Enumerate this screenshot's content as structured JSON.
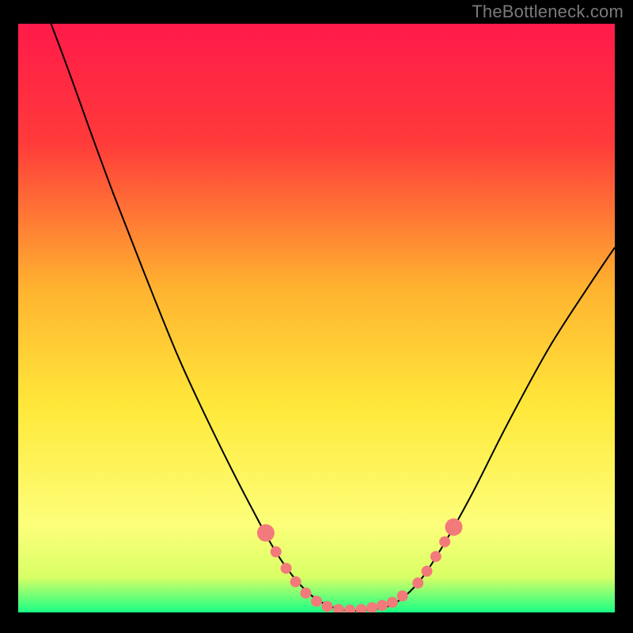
{
  "attribution": "TheBottleneck.com",
  "chart_data": {
    "type": "line",
    "title": "",
    "xlabel": "",
    "ylabel": "",
    "xlim": [
      0,
      100
    ],
    "ylim": [
      0,
      100
    ],
    "background_gradient": {
      "stops": [
        {
          "offset": 0.0,
          "color": "#ff1a4a"
        },
        {
          "offset": 0.2,
          "color": "#ff3a3a"
        },
        {
          "offset": 0.45,
          "color": "#ffb330"
        },
        {
          "offset": 0.65,
          "color": "#ffe83a"
        },
        {
          "offset": 0.85,
          "color": "#fdff7a"
        },
        {
          "offset": 0.94,
          "color": "#d9ff66"
        },
        {
          "offset": 1.0,
          "color": "#19ff84"
        }
      ]
    },
    "series": [
      {
        "name": "bottleneck-curve",
        "color": "#000000",
        "stroke_width": 2,
        "points": [
          {
            "x": 5.5,
            "y": 100.0
          },
          {
            "x": 7.0,
            "y": 96.0
          },
          {
            "x": 9.0,
            "y": 90.5
          },
          {
            "x": 12.0,
            "y": 82.0
          },
          {
            "x": 16.0,
            "y": 71.0
          },
          {
            "x": 21.0,
            "y": 58.0
          },
          {
            "x": 27.0,
            "y": 43.0
          },
          {
            "x": 33.0,
            "y": 30.0
          },
          {
            "x": 39.0,
            "y": 18.0
          },
          {
            "x": 44.0,
            "y": 9.0
          },
          {
            "x": 49.0,
            "y": 3.0
          },
          {
            "x": 54.0,
            "y": 0.5
          },
          {
            "x": 59.0,
            "y": 0.5
          },
          {
            "x": 63.0,
            "y": 1.5
          },
          {
            "x": 67.0,
            "y": 5.0
          },
          {
            "x": 71.0,
            "y": 11.0
          },
          {
            "x": 76.0,
            "y": 20.0
          },
          {
            "x": 82.0,
            "y": 32.0
          },
          {
            "x": 89.0,
            "y": 45.0
          },
          {
            "x": 96.0,
            "y": 56.0
          },
          {
            "x": 100.0,
            "y": 62.0
          }
        ]
      }
    ],
    "markers": {
      "name": "highlight-dots",
      "color": "#f27a7a",
      "radius": 7,
      "end_radius": 11,
      "points": [
        {
          "x": 41.5,
          "y": 13.5
        },
        {
          "x": 43.2,
          "y": 10.3
        },
        {
          "x": 44.9,
          "y": 7.5
        },
        {
          "x": 46.5,
          "y": 5.2
        },
        {
          "x": 48.2,
          "y": 3.3
        },
        {
          "x": 50.0,
          "y": 1.9
        },
        {
          "x": 51.8,
          "y": 1.0
        },
        {
          "x": 53.7,
          "y": 0.5
        },
        {
          "x": 55.6,
          "y": 0.4
        },
        {
          "x": 57.5,
          "y": 0.5
        },
        {
          "x": 59.3,
          "y": 0.8
        },
        {
          "x": 61.0,
          "y": 1.2
        },
        {
          "x": 62.7,
          "y": 1.7
        },
        {
          "x": 64.4,
          "y": 2.8
        },
        {
          "x": 67.0,
          "y": 5.0
        },
        {
          "x": 68.5,
          "y": 7.0
        },
        {
          "x": 70.0,
          "y": 9.5
        },
        {
          "x": 71.5,
          "y": 12.0
        },
        {
          "x": 73.0,
          "y": 14.5
        }
      ]
    }
  }
}
